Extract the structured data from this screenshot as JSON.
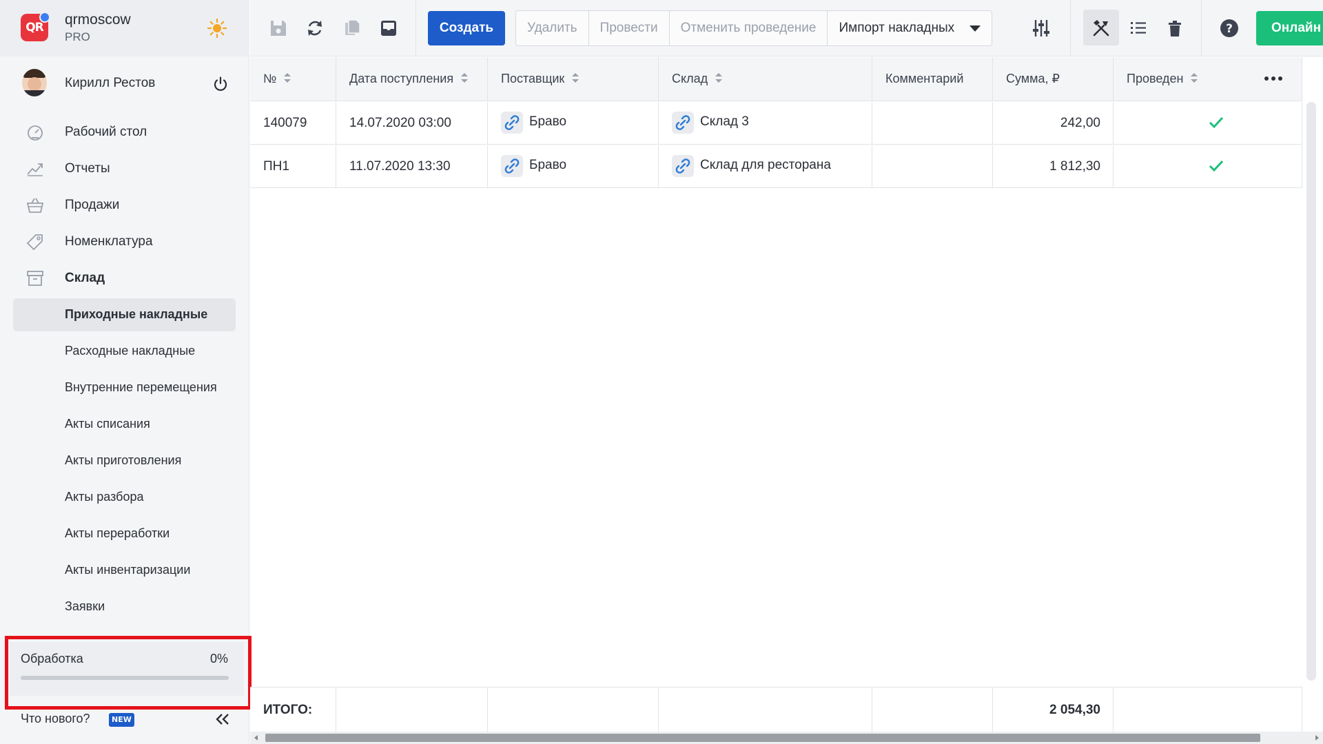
{
  "colors": {
    "primary": "#1d5cc9",
    "success": "#1bbf7a",
    "highlight": "#e5121b",
    "sidebar_bg": "#f4f5f7",
    "sun": "#f5a623"
  },
  "brand": {
    "logo_text": "QR",
    "name": "qrmoscow",
    "plan": "PRO",
    "theme_icon": "sun-icon"
  },
  "user": {
    "name": "Кирилл Рестов",
    "power_icon": "power-icon"
  },
  "nav": {
    "items": [
      {
        "label": "Рабочий стол",
        "icon": "dashboard-icon"
      },
      {
        "label": "Отчеты",
        "icon": "chart-icon"
      },
      {
        "label": "Продажи",
        "icon": "basket-icon"
      },
      {
        "label": "Номенклатура",
        "icon": "tag-icon"
      },
      {
        "label": "Склад",
        "icon": "archive-icon"
      }
    ],
    "sub_items": [
      {
        "label": "Приходные накладные",
        "active": true
      },
      {
        "label": "Расходные накладные"
      },
      {
        "label": "Внутренние перемещения"
      },
      {
        "label": "Акты списания"
      },
      {
        "label": "Акты приготовления"
      },
      {
        "label": "Акты разбора"
      },
      {
        "label": "Акты переработки"
      },
      {
        "label": "Акты инвентаризации"
      },
      {
        "label": "Заявки"
      }
    ]
  },
  "processing": {
    "label": "Обработка",
    "value_text": "0%",
    "progress": 0
  },
  "footer": {
    "whats_new": "Что нового?",
    "new_badge": "NEW"
  },
  "toolbar": {
    "create": "Создать",
    "delete": "Удалить",
    "post": "Провести",
    "unpost": "Отменить проведение",
    "import": "Импорт накладных",
    "online": "Онлайн"
  },
  "table": {
    "columns": [
      "№",
      "Дата поступления",
      "Поставщик",
      "Склад",
      "Комментарий",
      "Сумма, ₽",
      "Проведен"
    ],
    "rows": [
      {
        "number": "140079",
        "date": "14.07.2020 03:00",
        "supplier": "Браво",
        "warehouse": "Склад 3",
        "comment": "",
        "sum": "242,00",
        "posted": true
      },
      {
        "number": "ПН1",
        "date": "11.07.2020 13:30",
        "supplier": "Браво",
        "warehouse": "Склад для ресторана",
        "comment": "",
        "sum": "1 812,30",
        "posted": true
      }
    ],
    "total_label": "ИТОГО:",
    "total_sum": "2 054,30"
  }
}
